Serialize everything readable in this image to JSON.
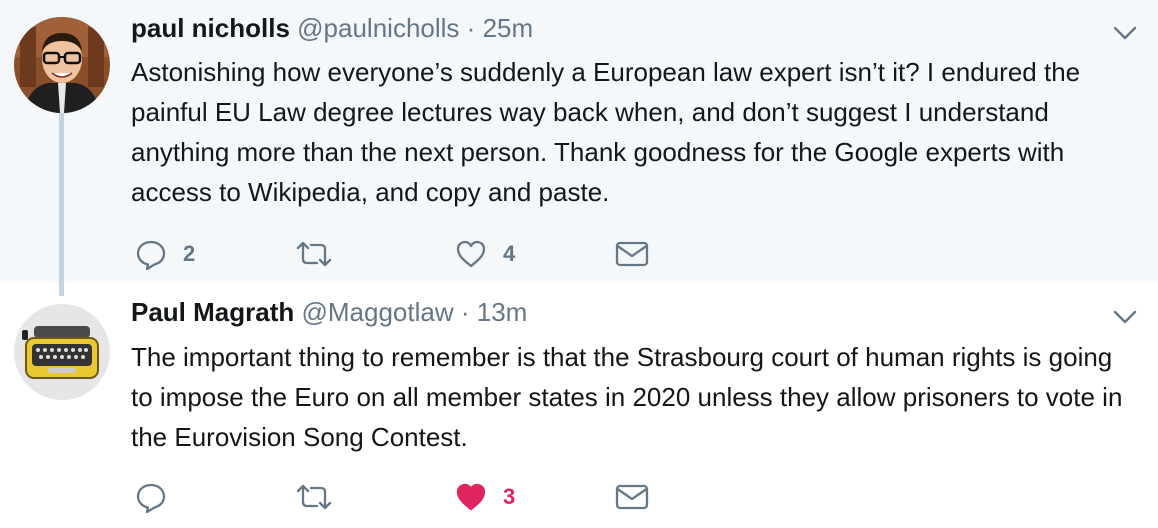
{
  "tweets": [
    {
      "name": "paul nicholls",
      "handle": "@paulnicholls",
      "separator": "·",
      "time": "25m",
      "text": "Astonishing how everyone’s suddenly a European law expert isn’t it? I endured the painful EU Law degree lectures way back when, and don’t suggest I understand anything more than the next person. Thank goodness for the Google experts with access to Wikipedia, and copy and paste.",
      "reply_count": "2",
      "retweet_count": "",
      "like_count": "4",
      "liked": false
    },
    {
      "name": "Paul Magrath",
      "handle": "@Maggotlaw",
      "separator": "·",
      "time": "13m",
      "text": "The important thing to remember is that the Strasbourg court of human rights is going to impose the Euro on all member states in 2020 unless they allow prisoners to vote in the Eurovision Song Contest.",
      "reply_count": "",
      "retweet_count": "",
      "like_count": "3",
      "liked": true
    }
  ],
  "colors": {
    "gray": "#657786",
    "like_red": "#e0245e",
    "thread_line": "#c4d4e2",
    "highlight_bg": "#f5f8fa"
  },
  "icons": [
    "reply-icon",
    "retweet-icon",
    "heart-icon",
    "envelope-icon",
    "chevron-down-icon"
  ]
}
